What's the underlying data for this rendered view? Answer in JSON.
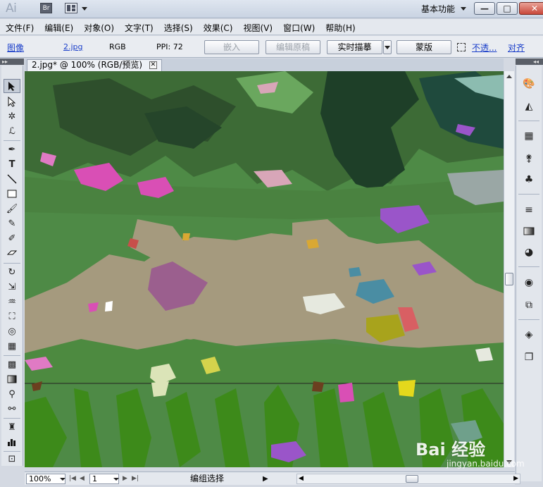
{
  "app": {
    "logo": "Ai",
    "bridge_label": "Br",
    "workspace_label": "基本功能",
    "window_buttons": {
      "minimize": "—",
      "restore": "□",
      "close": "✕"
    }
  },
  "menu": {
    "items": [
      "文件(F)",
      "编辑(E)",
      "对象(O)",
      "文字(T)",
      "选择(S)",
      "效果(C)",
      "视图(V)",
      "窗口(W)",
      "帮助(H)"
    ]
  },
  "control_bar": {
    "object_type": "图像",
    "filename": "2.jpg",
    "color_mode": "RGB",
    "ppi": "PPI: 72",
    "embed_button": "嵌入",
    "edit_original_button": "编辑原稿",
    "live_trace_button": "实时描摹",
    "mask_button": "蒙版",
    "opacity_link": "不透...",
    "align_link": "对齐"
  },
  "document": {
    "tab_label": "2.jpg* @ 100% (RGB/预览)",
    "tab_close": "✕"
  },
  "status_bar": {
    "zoom_value": "100%",
    "artboard_value": "1",
    "status_text": "编组选择"
  },
  "watermark": {
    "main": "Bai 经验",
    "sub": "jingyan.baidu.com"
  },
  "colors": {
    "canvas_green": "#4e8a46",
    "dark_green": "#2e4f2c",
    "path_tan": "#a59a7e",
    "magenta": "#d94fb5",
    "purple": "#9a55c9",
    "grass_green": "#3d8a1a",
    "link_blue": "#1a3ec9"
  }
}
